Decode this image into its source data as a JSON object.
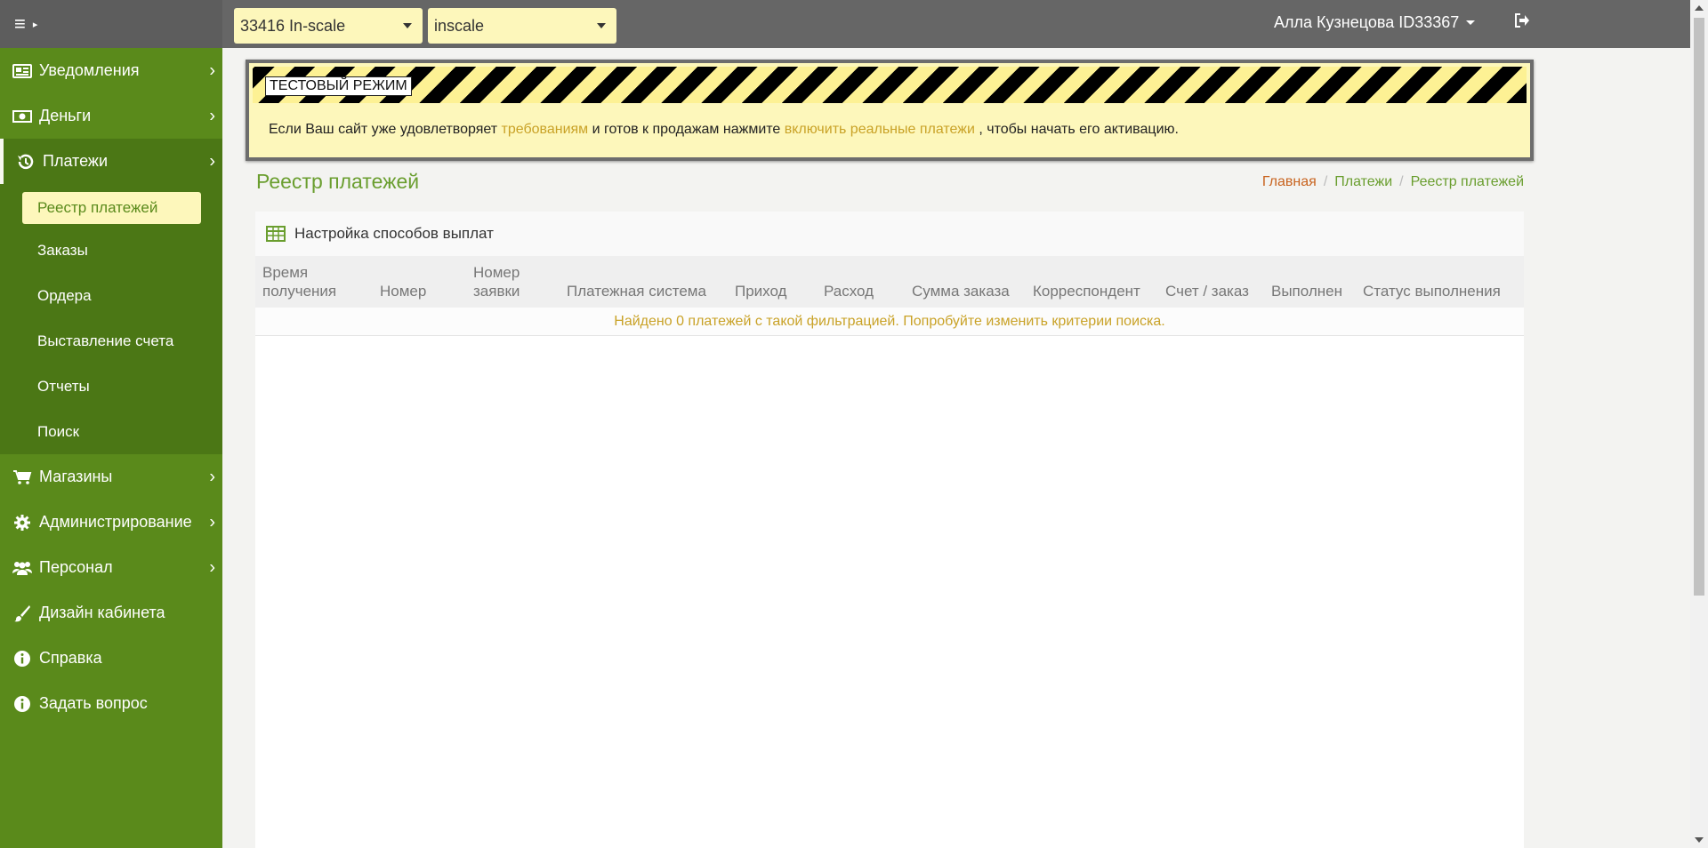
{
  "sidebar": {
    "items": [
      {
        "label": "Уведомления",
        "icon": "newspaper-icon"
      },
      {
        "label": "Деньги",
        "icon": "money-icon"
      },
      {
        "label": "Платежи",
        "icon": "history-icon"
      },
      {
        "label": "Магазины",
        "icon": "cart-icon"
      },
      {
        "label": "Администрирование",
        "icon": "gear-icon"
      },
      {
        "label": "Персонал",
        "icon": "users-icon"
      },
      {
        "label": "Дизайн кабинета",
        "icon": "brush-icon"
      },
      {
        "label": "Справка",
        "icon": "info-icon"
      },
      {
        "label": "Задать вопрос",
        "icon": "info-icon"
      }
    ],
    "sub_items": [
      {
        "label": "Реестр платежей"
      },
      {
        "label": "Заказы"
      },
      {
        "label": "Ордера"
      },
      {
        "label": "Выставление счета"
      },
      {
        "label": "Отчеты"
      },
      {
        "label": "Поиск"
      }
    ]
  },
  "topbar": {
    "shop_select": "33416 In-scale",
    "site_select": "inscale",
    "user": "Алла Кузнецова ID33367"
  },
  "banner": {
    "label": "ТЕСТОВЫЙ РЕЖИМ",
    "text1": "Если Ваш сайт уже удовлетворяет ",
    "link1": "требованиям",
    "text2": " и готов к продажам нажмите ",
    "link2": "включить реальные платежи",
    "text3": " , чтобы начать его активацию."
  },
  "page": {
    "title": "Реестр платежей",
    "breadcrumb": [
      "Главная",
      "Платежи",
      "Реестр платежей"
    ],
    "breadcrumb_sep": "/"
  },
  "panel": {
    "heading": "Настройка способов выплат",
    "columns": [
      "Время получения",
      "Номер",
      "Номер заявки",
      "Платежная система",
      "Приход",
      "Расход",
      "Сумма заказа",
      "Корреспондент",
      "Счет / заказ",
      "Выполнен",
      "Статус выполнения"
    ],
    "empty_message": "Найдено 0 платежей с такой фильтрацией. Попробуйте изменить критерии поиска."
  },
  "colors": {
    "sidebar": "#5a8a1b",
    "sidebar_active": "#4b7715",
    "accent_yellow": "#fdf7bb",
    "link_gold": "#c9a227",
    "title_green": "#6a9e2f",
    "breadcrumb_home": "#c8631f",
    "topbar": "#666666"
  }
}
